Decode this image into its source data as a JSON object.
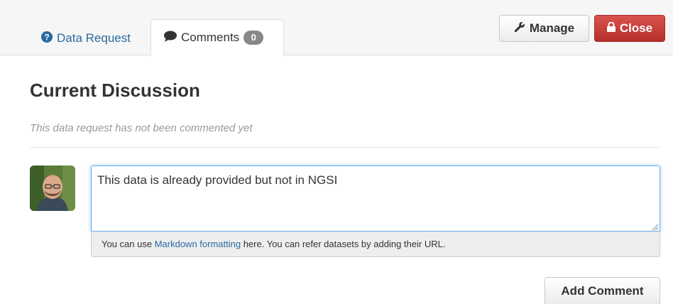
{
  "tabs": {
    "data_request": {
      "label": "Data Request",
      "icon": "question-circle-icon"
    },
    "comments": {
      "label": "Comments",
      "count": "0",
      "icon": "comment-icon"
    }
  },
  "actions": {
    "manage_label": "Manage",
    "manage_icon": "wrench-icon",
    "close_label": "Close",
    "close_icon": "lock-icon"
  },
  "discussion": {
    "title": "Current Discussion",
    "empty_message": "This data request has not been commented yet"
  },
  "comment_form": {
    "value": "This data is already provided but not in NGSI",
    "help_prefix": "You can use ",
    "help_link": "Markdown formatting",
    "help_suffix": " here. You can refer datasets by adding their URL.",
    "submit_label": "Add Comment"
  },
  "colors": {
    "link": "#2b6aa0",
    "danger": "#c9302c",
    "focus": "#66afe9",
    "badge": "#888888"
  }
}
